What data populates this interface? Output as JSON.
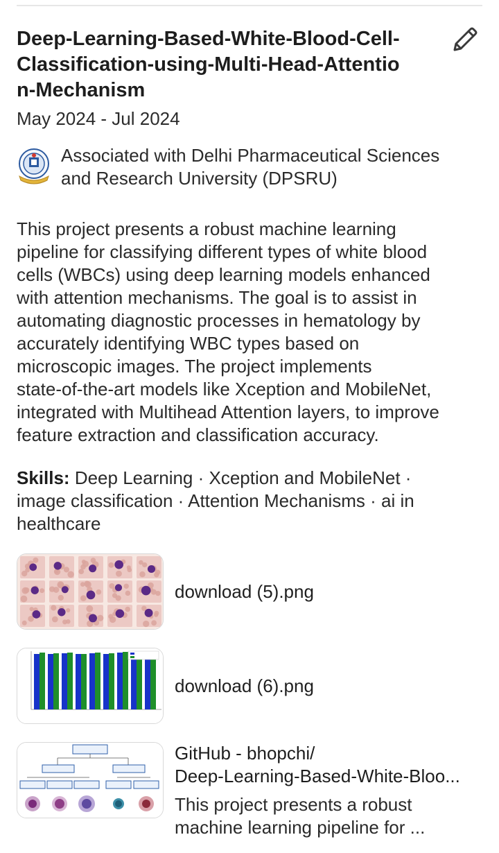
{
  "project": {
    "title_lines": [
      "Deep-Learning-Based-White-Blood-Cell-",
      "Classification-using-Multi-Head-Attentio",
      "n-Mechanism"
    ],
    "dates": "May 2024 - Jul 2024",
    "association_lines": [
      "Associated with Delhi Pharmaceutical Sciences",
      "and Research University (DPSRU)"
    ],
    "description_lines": [
      "This project presents a robust machine learning",
      "pipeline for classifying different types of white blood",
      "cells (WBCs) using deep learning models enhanced",
      "with attention mechanisms. The goal is to assist in",
      "automating diagnostic processes in hematology by",
      "accurately identifying WBC types based on",
      "microscopic images. The project implements",
      "state-of-the-art models like Xception and MobileNet,",
      "integrated with Multihead Attention layers, to improve",
      "feature extraction and classification accuracy."
    ],
    "skills": {
      "label": "Skills:",
      "lines": [
        " Deep Learning · Xception and MobileNet ·",
        "image classification · Attention Mechanisms · ai in",
        "healthcare"
      ]
    }
  },
  "media": [
    {
      "label": "download (5).png"
    },
    {
      "label": "download (6).png"
    },
    {
      "title_lines": [
        "GitHub - bhopchi/",
        "Deep-Learning-Based-White-Bloo..."
      ],
      "desc_lines": [
        "This project presents a robust",
        "machine learning pipeline for ..."
      ]
    }
  ],
  "icons": {
    "edit": "pencil-icon",
    "logo": "university-seal"
  },
  "colors": {
    "bar_blue": "#1733c9",
    "bar_green": "#1f8f2a",
    "diagram_box": "#2f5fa8"
  }
}
